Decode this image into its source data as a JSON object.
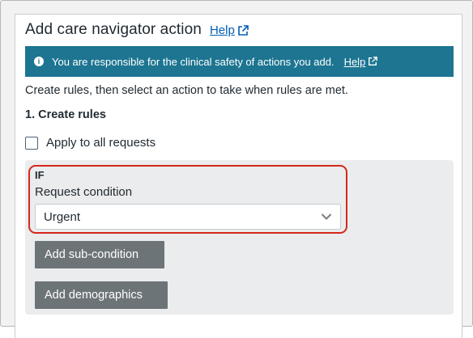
{
  "header": {
    "title": "Add care navigator action",
    "help_label": "Help"
  },
  "banner": {
    "message": "You are responsible for the clinical safety of actions you add.",
    "help_label": "Help",
    "color": "#1d7591"
  },
  "description": "Create rules, then select an action to take when rules are met.",
  "section": {
    "heading": "1. Create rules"
  },
  "apply_all": {
    "label": "Apply to all requests",
    "checked": false
  },
  "rule": {
    "if_label": "IF",
    "condition_label": "Request condition",
    "condition_value": "Urgent"
  },
  "buttons": {
    "add_sub_condition": "Add sub-condition",
    "add_demographics": "Add demographics"
  },
  "colors": {
    "link": "#005eb8",
    "highlight": "#d5281b",
    "button": "#6d7478"
  },
  "icons": [
    "external-link-icon",
    "info-icon",
    "chevron-down-icon"
  ]
}
